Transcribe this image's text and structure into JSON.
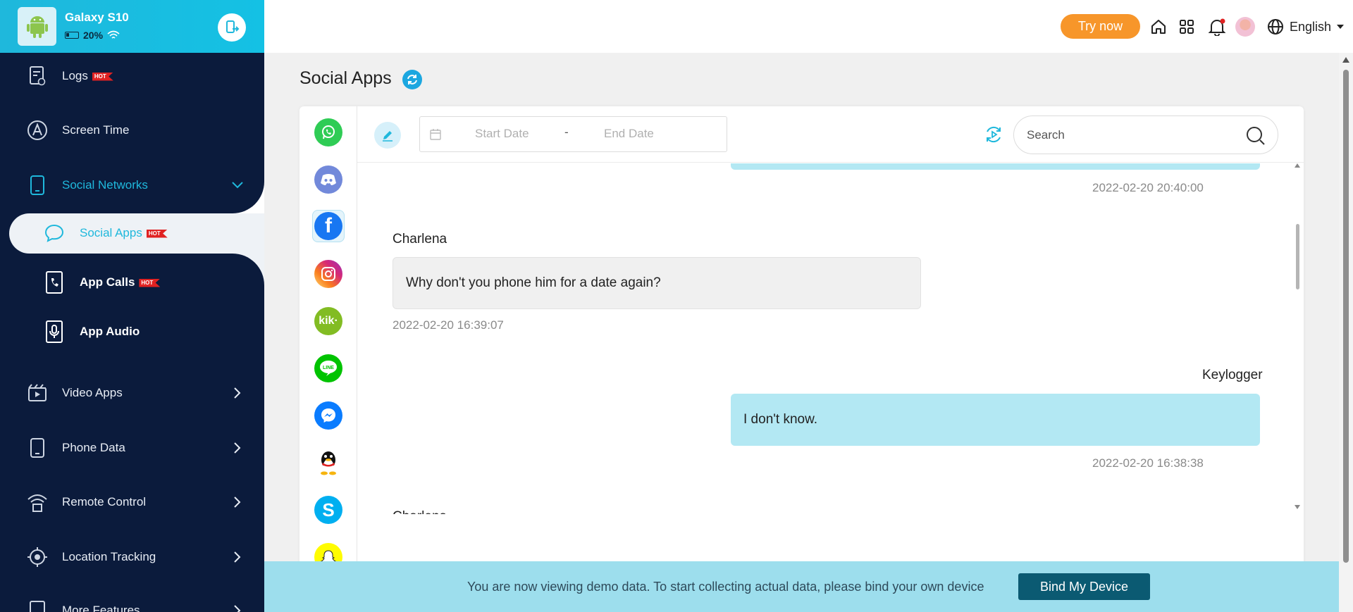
{
  "device": {
    "name": "Galaxy S10",
    "battery": "20%"
  },
  "sidebar": {
    "items": [
      {
        "label": "Logs",
        "badge": "HOT"
      },
      {
        "label": "Screen Time"
      },
      {
        "label": "Social Networks"
      },
      {
        "label": "Social Apps",
        "badge": "HOT"
      },
      {
        "label": "App Calls",
        "badge": "HOT"
      },
      {
        "label": "App Audio"
      },
      {
        "label": "Video Apps"
      },
      {
        "label": "Phone Data"
      },
      {
        "label": "Remote Control"
      },
      {
        "label": "Location Tracking"
      },
      {
        "label": "More Features"
      }
    ]
  },
  "header": {
    "try_now": "Try now",
    "language": "English"
  },
  "page": {
    "title": "Social Apps"
  },
  "apps": [
    "whatsapp",
    "discord",
    "facebook",
    "instagram",
    "kik",
    "line",
    "messenger",
    "qq",
    "skype",
    "snapchat"
  ],
  "toolbar": {
    "start_date_placeholder": "Start Date",
    "dash": "-",
    "end_date_placeholder": "End Date",
    "search_placeholder": "Search"
  },
  "messages": [
    {
      "side": "right",
      "sender": "",
      "text": "",
      "time": "2022-02-20 20:40:00"
    },
    {
      "side": "left",
      "sender": "Charlena",
      "text": "Why don't you phone him for a date again?",
      "time": "2022-02-20 16:39:07"
    },
    {
      "side": "right",
      "sender": "Keylogger",
      "text": "I don't know.",
      "time": "2022-02-20 16:38:38"
    },
    {
      "side": "left",
      "sender": "Charlena",
      "text": "",
      "time": ""
    }
  ],
  "banner": {
    "text": "You are now viewing demo data. To start collecting actual data, please bind your own device",
    "button": "Bind My Device"
  },
  "colors": {
    "sidebar_bg": "#0b1b3c",
    "accent": "#1fb8dc",
    "try_now": "#f7962a",
    "bubble_right": "#b3e8f3",
    "banner_bg": "#9ddeed",
    "bind_button": "#0b5a72"
  }
}
